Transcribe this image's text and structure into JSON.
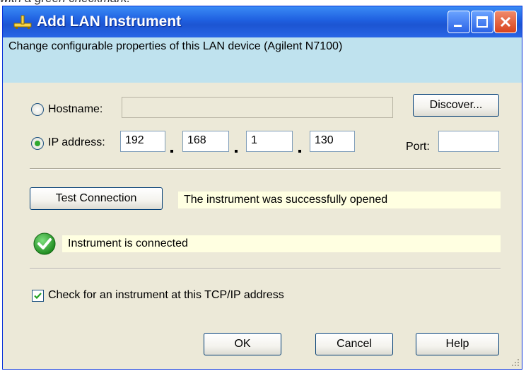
{
  "page_caption": "with a green checkmark.",
  "window": {
    "title": "Add LAN Instrument",
    "description": "Change configurable properties of this LAN device (Agilent N7100)"
  },
  "connection": {
    "hostname_label": "Hostname:",
    "hostname_value": "",
    "hostname_selected": false,
    "ip_label": "IP address:",
    "ip_selected": true,
    "ip_octets": [
      "192",
      "168",
      "1",
      "130"
    ],
    "port_label": "Port:",
    "port_value": "",
    "discover_label": "Discover..."
  },
  "test": {
    "button_label": "Test Connection",
    "result_message": "The instrument was successfully opened",
    "status_message": "Instrument is connected",
    "status_icon": "green-checkmark-icon"
  },
  "options": {
    "check_tcpip_label": "Check for an instrument at this TCP/IP address",
    "check_tcpip_checked": true
  },
  "footer": {
    "ok_label": "OK",
    "cancel_label": "Cancel",
    "help_label": "Help"
  },
  "colors": {
    "titlebar": "#2a66e6",
    "info_strip": "#bfe2ee",
    "status_background": "#ffffe1",
    "success_green": "#2fa82f"
  }
}
